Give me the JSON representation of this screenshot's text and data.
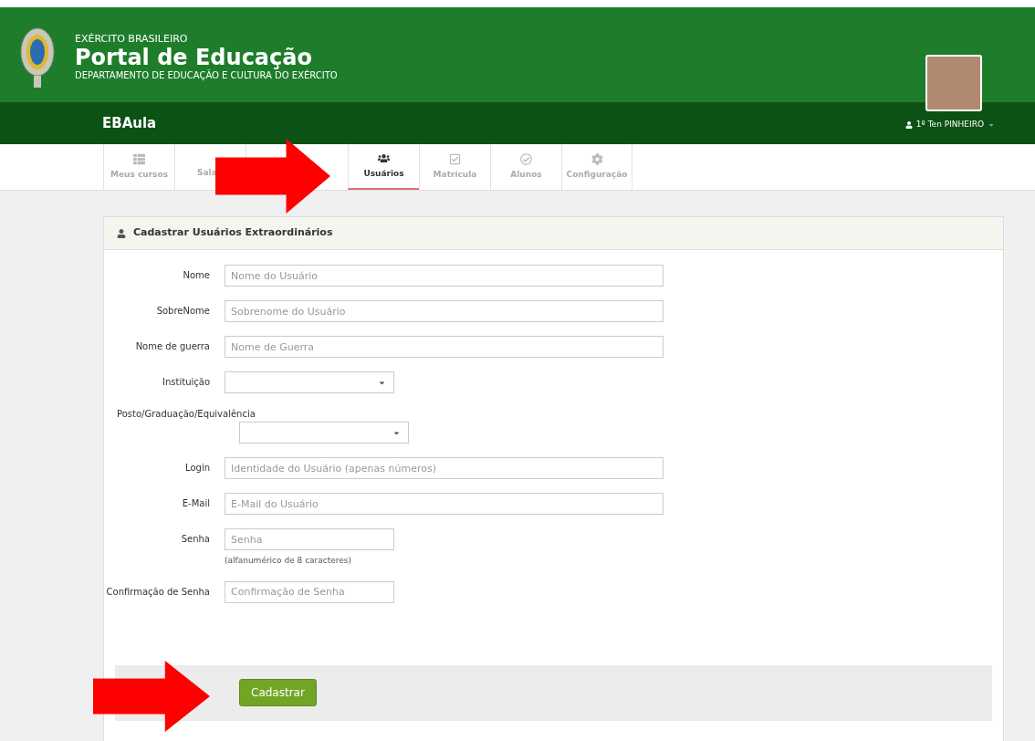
{
  "header": {
    "overline": "EXÉRCITO BRASILEIRO",
    "title": "Portal de Educação",
    "subtitle": "DEPARTAMENTO DE EDUCAÇÃO E CULTURA DO EXÉRCITO"
  },
  "navbar": {
    "brand": "EBAula",
    "user": "1º Ten PINHEIRO"
  },
  "tabs": [
    {
      "label": "Meus cursos",
      "kind": "full",
      "selected": false
    },
    {
      "label": "Sala",
      "kind": "covered",
      "selected": false
    },
    {
      "label": "Usuários",
      "kind": "full",
      "selected": true
    },
    {
      "label": "Matrícula",
      "kind": "full",
      "selected": false
    },
    {
      "label": "Alunos",
      "kind": "full",
      "selected": false
    },
    {
      "label": "Configuração",
      "kind": "full",
      "selected": false
    }
  ],
  "panel": {
    "title": "Cadastrar Usuários Extraordinários",
    "fields": [
      {
        "label": "Nome",
        "kind": "text",
        "placeholder": "Nome do Usuário"
      },
      {
        "label": "SobreNome",
        "kind": "text",
        "placeholder": "Sobrenome do Usuário"
      },
      {
        "label": "Nome de guerra",
        "kind": "text",
        "placeholder": "Nome de Guerra"
      },
      {
        "label": "Instituição",
        "kind": "select"
      },
      {
        "label": "Posto/Graduação/Equivalência",
        "kind": "select-stacked"
      },
      {
        "label": "Login",
        "kind": "text",
        "placeholder": "Identidade do Usuário (apenas números)"
      },
      {
        "label": "E-Mail",
        "kind": "text",
        "placeholder": "E-Mail do Usuário"
      },
      {
        "label": "Senha",
        "kind": "short-text",
        "placeholder": "Senha",
        "help": "(alfanumérico de 8 caracteres)"
      },
      {
        "label": "Confirmação de Senha",
        "kind": "short-text",
        "placeholder": "Confirmação de Senha"
      }
    ],
    "submit": "Cadastrar"
  }
}
